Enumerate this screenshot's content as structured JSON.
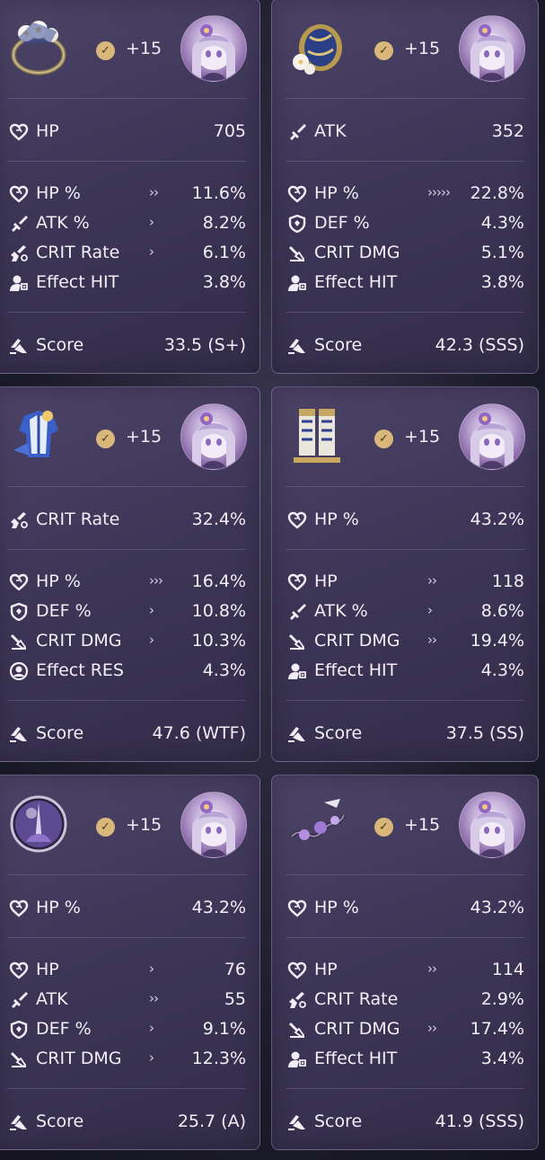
{
  "cards": [
    {
      "piece_icon": "head-relic-icon",
      "level": "+15",
      "main": {
        "name": "HP",
        "value": "705",
        "icon": "heart-icon"
      },
      "subs": [
        {
          "name": "HP %",
          "value": "11.6%",
          "rolls": "››",
          "icon": "heart-icon"
        },
        {
          "name": "ATK %",
          "value": "8.2%",
          "rolls": "›",
          "icon": "sword-icon"
        },
        {
          "name": "CRIT Rate",
          "value": "6.1%",
          "rolls": "›",
          "icon": "crit-rate-icon"
        },
        {
          "name": "Effect HIT",
          "value": "3.8%",
          "rolls": "",
          "icon": "effect-hit-icon"
        }
      ],
      "score": {
        "label": "Score",
        "value": "33.5 (S+)"
      }
    },
    {
      "piece_icon": "hands-relic-icon",
      "level": "+15",
      "main": {
        "name": "ATK",
        "value": "352",
        "icon": "sword-icon"
      },
      "subs": [
        {
          "name": "HP %",
          "value": "22.8%",
          "rolls": "›››››",
          "icon": "heart-icon"
        },
        {
          "name": "DEF %",
          "value": "4.3%",
          "rolls": "",
          "icon": "shield-icon"
        },
        {
          "name": "CRIT DMG",
          "value": "5.1%",
          "rolls": "",
          "icon": "crit-dmg-icon"
        },
        {
          "name": "Effect HIT",
          "value": "3.8%",
          "rolls": "",
          "icon": "effect-hit-icon"
        }
      ],
      "score": {
        "label": "Score",
        "value": "42.3 (SSS)"
      }
    },
    {
      "piece_icon": "body-relic-icon",
      "level": "+15",
      "main": {
        "name": "CRIT Rate",
        "value": "32.4%",
        "icon": "crit-rate-icon"
      },
      "subs": [
        {
          "name": "HP %",
          "value": "16.4%",
          "rolls": "›››",
          "icon": "heart-icon"
        },
        {
          "name": "DEF %",
          "value": "10.8%",
          "rolls": "›",
          "icon": "shield-icon"
        },
        {
          "name": "CRIT DMG",
          "value": "10.3%",
          "rolls": "›",
          "icon": "crit-dmg-icon"
        },
        {
          "name": "Effect RES",
          "value": "4.3%",
          "rolls": "",
          "icon": "effect-res-icon"
        }
      ],
      "score": {
        "label": "Score",
        "value": "47.6 (WTF)"
      }
    },
    {
      "piece_icon": "feet-relic-icon",
      "level": "+15",
      "main": {
        "name": "HP %",
        "value": "43.2%",
        "icon": "heart-icon"
      },
      "subs": [
        {
          "name": "HP",
          "value": "118",
          "rolls": "››",
          "icon": "heart-icon"
        },
        {
          "name": "ATK %",
          "value": "8.6%",
          "rolls": "›",
          "icon": "sword-icon"
        },
        {
          "name": "CRIT DMG",
          "value": "19.4%",
          "rolls": "››",
          "icon": "crit-dmg-icon"
        },
        {
          "name": "Effect HIT",
          "value": "4.3%",
          "rolls": "",
          "icon": "effect-hit-icon"
        }
      ],
      "score": {
        "label": "Score",
        "value": "37.5 (SS)"
      }
    },
    {
      "piece_icon": "sphere-ornament-icon",
      "level": "+15",
      "main": {
        "name": "HP %",
        "value": "43.2%",
        "icon": "heart-icon"
      },
      "subs": [
        {
          "name": "HP",
          "value": "76",
          "rolls": "›",
          "icon": "heart-icon"
        },
        {
          "name": "ATK",
          "value": "55",
          "rolls": "››",
          "icon": "sword-icon"
        },
        {
          "name": "DEF %",
          "value": "9.1%",
          "rolls": "›",
          "icon": "shield-icon"
        },
        {
          "name": "CRIT DMG",
          "value": "12.3%",
          "rolls": "›",
          "icon": "crit-dmg-icon"
        }
      ],
      "score": {
        "label": "Score",
        "value": "25.7 (A)"
      }
    },
    {
      "piece_icon": "rope-ornament-icon",
      "level": "+15",
      "main": {
        "name": "HP %",
        "value": "43.2%",
        "icon": "heart-icon"
      },
      "subs": [
        {
          "name": "HP",
          "value": "114",
          "rolls": "››",
          "icon": "heart-icon"
        },
        {
          "name": "CRIT Rate",
          "value": "2.9%",
          "rolls": "",
          "icon": "crit-rate-icon"
        },
        {
          "name": "CRIT DMG",
          "value": "17.4%",
          "rolls": "››",
          "icon": "crit-dmg-icon"
        },
        {
          "name": "Effect HIT",
          "value": "3.4%",
          "rolls": "",
          "icon": "effect-hit-icon"
        }
      ],
      "score": {
        "label": "Score",
        "value": "41.9 (SSS)"
      }
    }
  ],
  "colors": {
    "accent_check": "#d9b77a",
    "card_bg": "#3d3657",
    "text": "#f2eef8"
  }
}
